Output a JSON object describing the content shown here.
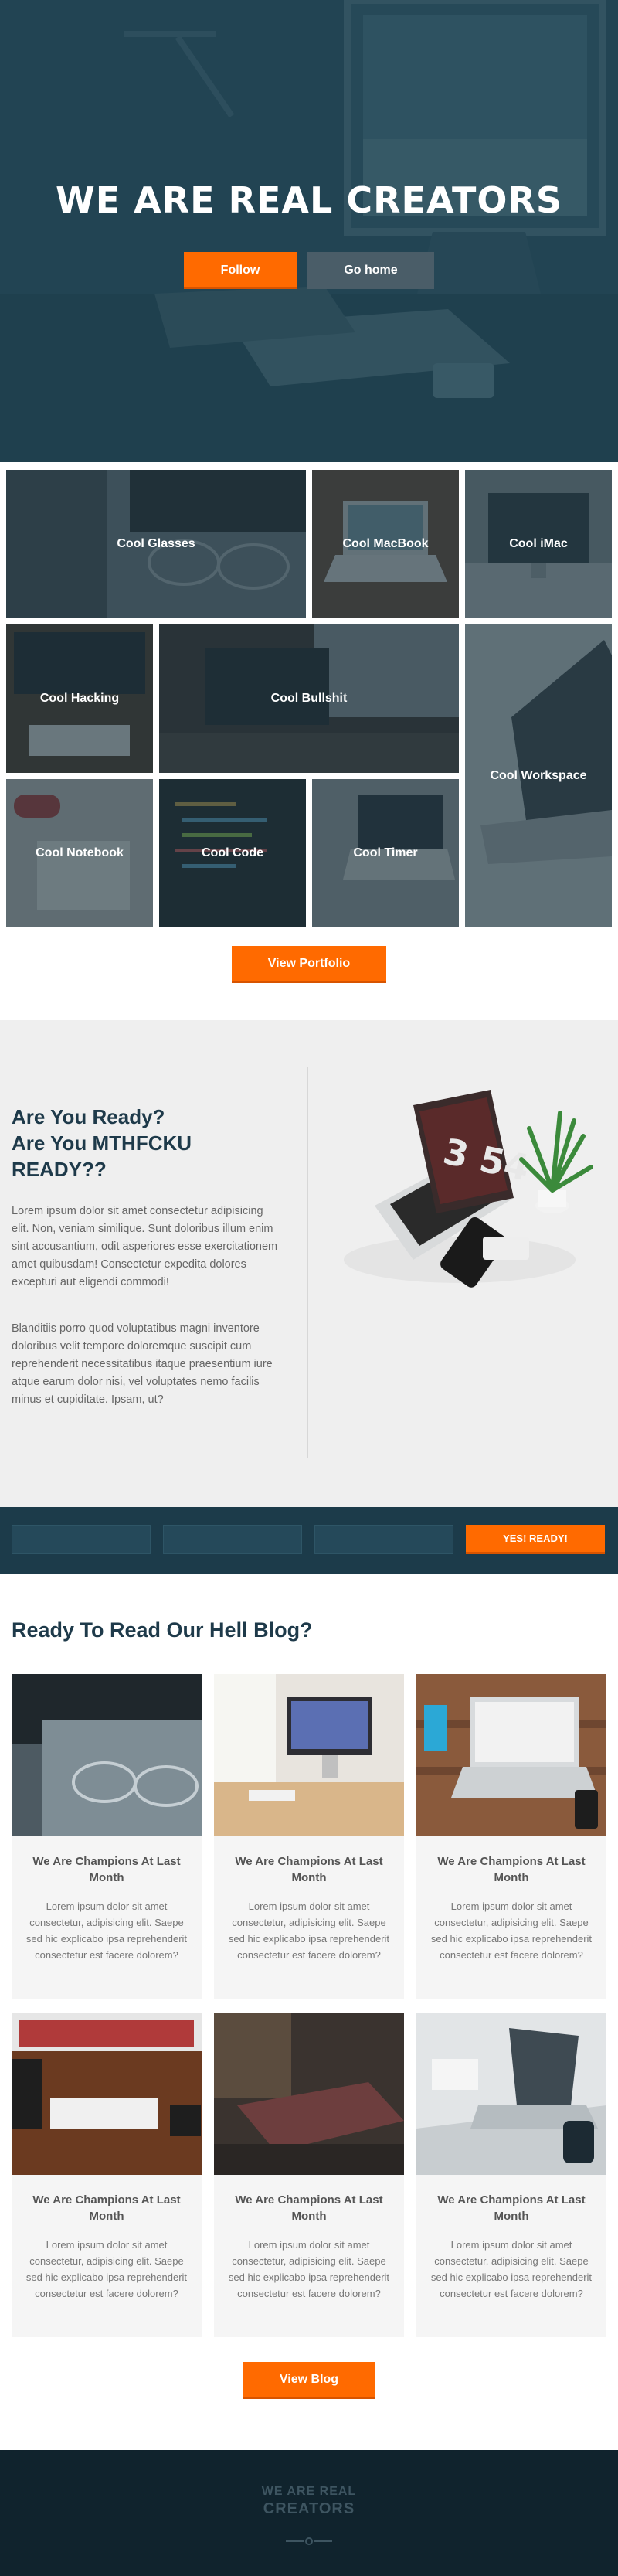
{
  "hero": {
    "title": "WE ARE REAL CREATORS",
    "follow_label": "Follow",
    "home_label": "Go home"
  },
  "portfolio": {
    "tiles": [
      {
        "label": "Cool Glasses"
      },
      {
        "label": "Cool MacBook"
      },
      {
        "label": "Cool iMac"
      },
      {
        "label": "Cool Hacking"
      },
      {
        "label": "Cool Bullshit"
      },
      {
        "label": "Cool Workspace"
      },
      {
        "label": "Cool Notebook"
      },
      {
        "label": "Cool Code"
      },
      {
        "label": "Cool Timer"
      }
    ],
    "button_label": "View Portfolio"
  },
  "ready": {
    "heading_line1": "Are You Ready?",
    "heading_line2": "Are You MTHFCKU",
    "heading_line3": "READY??",
    "paragraph1": "Lorem ipsum dolor sit amet consectetur adipisicing elit. Non, veniam similique. Sunt doloribus illum enim sint accusantium, odit asperiores esse exercitationem amet quibusdam! Consectetur expedita dolores excepturi aut eligendi commodi!",
    "paragraph2": "Blanditiis porro quod voluptatibus magni inventore doloribus velit tempore doloremque suscipit cum reprehenderit necessitatibus itaque praesentium iure atque earum dolor nisi, vel voluptates nemo facilis minus et cupiditate. Ipsam, ut?",
    "clock_text": "3 54"
  },
  "subscribe": {
    "field1_placeholder": "",
    "field2_placeholder": "",
    "field3_placeholder": "",
    "button_label": "YES! READY!"
  },
  "blog": {
    "title": "Ready To Read Our Hell Blog?",
    "cards": [
      {
        "title": "We Are Champions At Last Month",
        "text": "Lorem ipsum dolor sit amet consectetur, adipisicing elit. Saepe sed hic explicabo ipsa reprehenderit consectetur est facere dolorem?"
      },
      {
        "title": "We Are Champions At Last Month",
        "text": "Lorem ipsum dolor sit amet consectetur, adipisicing elit. Saepe sed hic explicabo ipsa reprehenderit consectetur est facere dolorem?"
      },
      {
        "title": "We Are Champions At Last Month",
        "text": "Lorem ipsum dolor sit amet consectetur, adipisicing elit. Saepe sed hic explicabo ipsa reprehenderit consectetur est facere dolorem?"
      },
      {
        "title": "We Are Champions At Last Month",
        "text": "Lorem ipsum dolor sit amet consectetur, adipisicing elit. Saepe sed hic explicabo ipsa reprehenderit consectetur est facere dolorem?"
      },
      {
        "title": "We Are Champions At Last Month",
        "text": "Lorem ipsum dolor sit amet consectetur, adipisicing elit. Saepe sed hic explicabo ipsa reprehenderit consectetur est facere dolorem?"
      },
      {
        "title": "We Are Champions At Last Month",
        "text": "Lorem ipsum dolor sit amet consectetur, adipisicing elit. Saepe sed hic explicabo ipsa reprehenderit consectetur est facere dolorem?"
      }
    ],
    "button_label": "View Blog"
  },
  "footer": {
    "line1": "WE ARE REAL",
    "line2": "CREATORS"
  },
  "colors": {
    "accent": "#ff6a00",
    "dark_navy": "#1c3b4a",
    "footer_bg": "#10232d",
    "heading": "#1e3a4a"
  }
}
